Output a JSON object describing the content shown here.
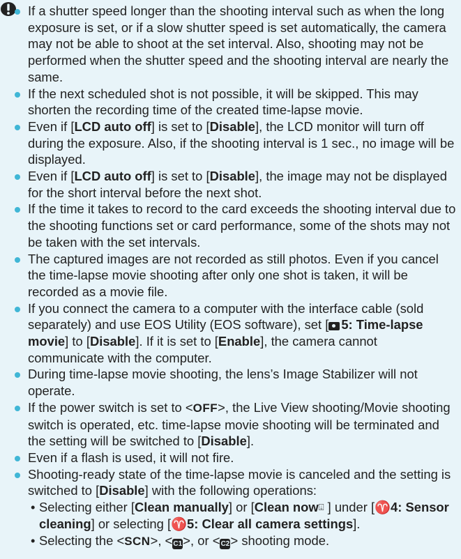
{
  "caution_icon": "caution-alert-icon",
  "colors": {
    "background": "#e8f4f9",
    "bullet": "#40b6d6",
    "text": "#222222"
  },
  "notes": [
    "If a shutter speed longer than the shooting interval such as when the long exposure is set, or if a slow shutter speed is set automatically, the camera may not be able to shoot at the set interval. Also, shooting may not be performed when the shutter speed and the shooting interval are nearly the same.",
    "If the next scheduled shot is not possible, it will be skipped. This may shorten the recording time of the created time-lapse movie.",
    {
      "t1": "Even if [",
      "b1": "LCD auto off",
      "t2": "] is set to [",
      "b2": "Disable",
      "t3": "], the LCD monitor will turn off during the exposure. Also, if the shooting interval is 1 sec., no image will be displayed."
    },
    {
      "t1": "Even if [",
      "b1": "LCD auto off",
      "t2": "] is set to [",
      "b2": "Disable",
      "t3": "], the image may not be displayed for the short interval before the next shot."
    },
    "If the time it takes to record to the card exceeds the shooting interval due to the shooting functions set or card performance, some of the shots may not be taken with the set intervals.",
    "The captured images are not recorded as still photos. Even if you cancel the time-lapse movie shooting after only one shot is taken, it will be recorded as a movie file.",
    {
      "t1": "If you connect the camera to a computer with the interface cable (sold separately) and use EOS Utility (EOS software), set [",
      "icon": "camera-icon",
      "b1": "5: Time-lapse movie",
      "t2": "] to [",
      "b2": "Disable",
      "t3": "]. If it is set to [",
      "b3": "Enable",
      "t4": "], the camera cannot communicate with the computer."
    },
    "During time-lapse movie shooting, the lens’s Image Stabilizer will not operate.",
    {
      "t1": "If the power switch is set to <",
      "g1": "OFF",
      "t2": ">, the Live View shooting/Movie shooting switch is operated, etc. time-lapse movie shooting will be terminated and the setting will be switched to [",
      "b1": "Disable",
      "t3": "]."
    },
    "Even if a flash is used, it will not fire.",
    {
      "t1": "Shooting-ready state of the time-lapse movie is canceled and the setting is switched to [",
      "b1": "Disable",
      "t2": "] with the following operations:",
      "sub": [
        {
          "bullet": "•",
          "t1": "Selecting either [",
          "b1": "Clean manually",
          "t2": "] or [",
          "b2": "Clean now",
          "icon": "trash-icon",
          "t3": " ] under [",
          "w1": "♈",
          "b3": "4: Sensor cleaning",
          "t4": "] or selecting [",
          "w2": "♈",
          "b4": "5: Clear all camera settings",
          "t5": "]."
        },
        {
          "bullet": "•",
          "t1": "Selecting the <",
          "g1": "SCN",
          "t2": ">, <",
          "m1": "C1",
          "t3": ">, or <",
          "m2": "C2",
          "t4": "> shooting mode."
        }
      ]
    }
  ]
}
